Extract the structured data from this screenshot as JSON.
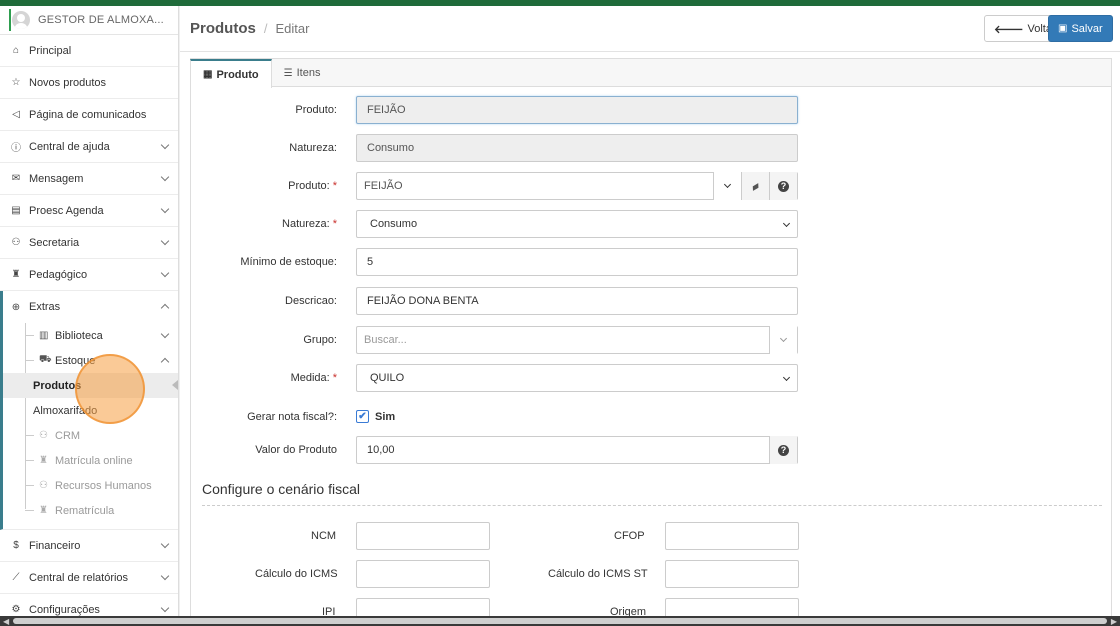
{
  "sidebar": {
    "user": "GESTOR DE ALMOXA...",
    "items": [
      {
        "label": "Principal",
        "icon": "home-icon"
      },
      {
        "label": "Novos produtos",
        "icon": "star-icon"
      },
      {
        "label": "Página de comunicados",
        "icon": "megaphone-icon"
      },
      {
        "label": "Central de ajuda",
        "icon": "info-icon"
      },
      {
        "label": "Mensagem",
        "icon": "envelope-icon"
      },
      {
        "label": "Proesc Agenda",
        "icon": "agenda-icon"
      },
      {
        "label": "Secretaria",
        "icon": "users-icon"
      },
      {
        "label": "Pedagógico",
        "icon": "graduation-icon"
      },
      {
        "label": "Extras",
        "icon": "plus-circle-icon"
      },
      {
        "label": "Financeiro",
        "icon": "dollar-icon"
      },
      {
        "label": "Central de relatórios",
        "icon": "chart-line-icon"
      },
      {
        "label": "Configurações",
        "icon": "gear-icon"
      }
    ],
    "extras": {
      "biblioteca": "Biblioteca",
      "estoque": "Estoque",
      "produtos": "Produtos",
      "almoxarifado": "Almoxarifado",
      "crm": "CRM",
      "matricula": "Matrícula online",
      "rh": "Recursos Humanos",
      "rematricula": "Rematrícula"
    }
  },
  "header": {
    "title": "Produtos",
    "separator": "/",
    "subtitle": "Editar",
    "back_label": "Voltar",
    "save_label": "Salvar"
  },
  "tabs": [
    {
      "label": "Produto",
      "active": true
    },
    {
      "label": "Itens",
      "active": false
    }
  ],
  "form": {
    "produto_ro": {
      "label": "Produto:",
      "value": "FEIJÃO"
    },
    "natureza_ro": {
      "label": "Natureza:",
      "value": "Consumo"
    },
    "produto": {
      "label": "Produto:",
      "value": "FEIJÃO"
    },
    "natureza": {
      "label": "Natureza:",
      "value": "Consumo"
    },
    "minimo": {
      "label": "Mínimo de estoque:",
      "value": "5"
    },
    "descricao": {
      "label": "Descricao:",
      "value": "FEIJÃO DONA BENTA"
    },
    "grupo": {
      "label": "Grupo:",
      "placeholder": "Buscar..."
    },
    "medida": {
      "label": "Medida:",
      "value": "QUILO"
    },
    "nota_fiscal": {
      "label": "Gerar nota fiscal?:",
      "value": "Sim",
      "checked": true
    },
    "valor": {
      "label": "Valor do Produto",
      "value": "10,00"
    },
    "required_mark": "*"
  },
  "fiscal": {
    "title": "Configure o cenário fiscal",
    "ncm": "NCM",
    "cfop": "CFOP",
    "icms": "Cálculo do ICMS",
    "icms_st": "Cálculo do ICMS ST",
    "ipi": "IPI",
    "origem": "Origem"
  },
  "colors": {
    "primary": "#337ab7",
    "accent": "#3a7d8c",
    "topbar": "#1f6b3a",
    "required": "#c9302c"
  }
}
